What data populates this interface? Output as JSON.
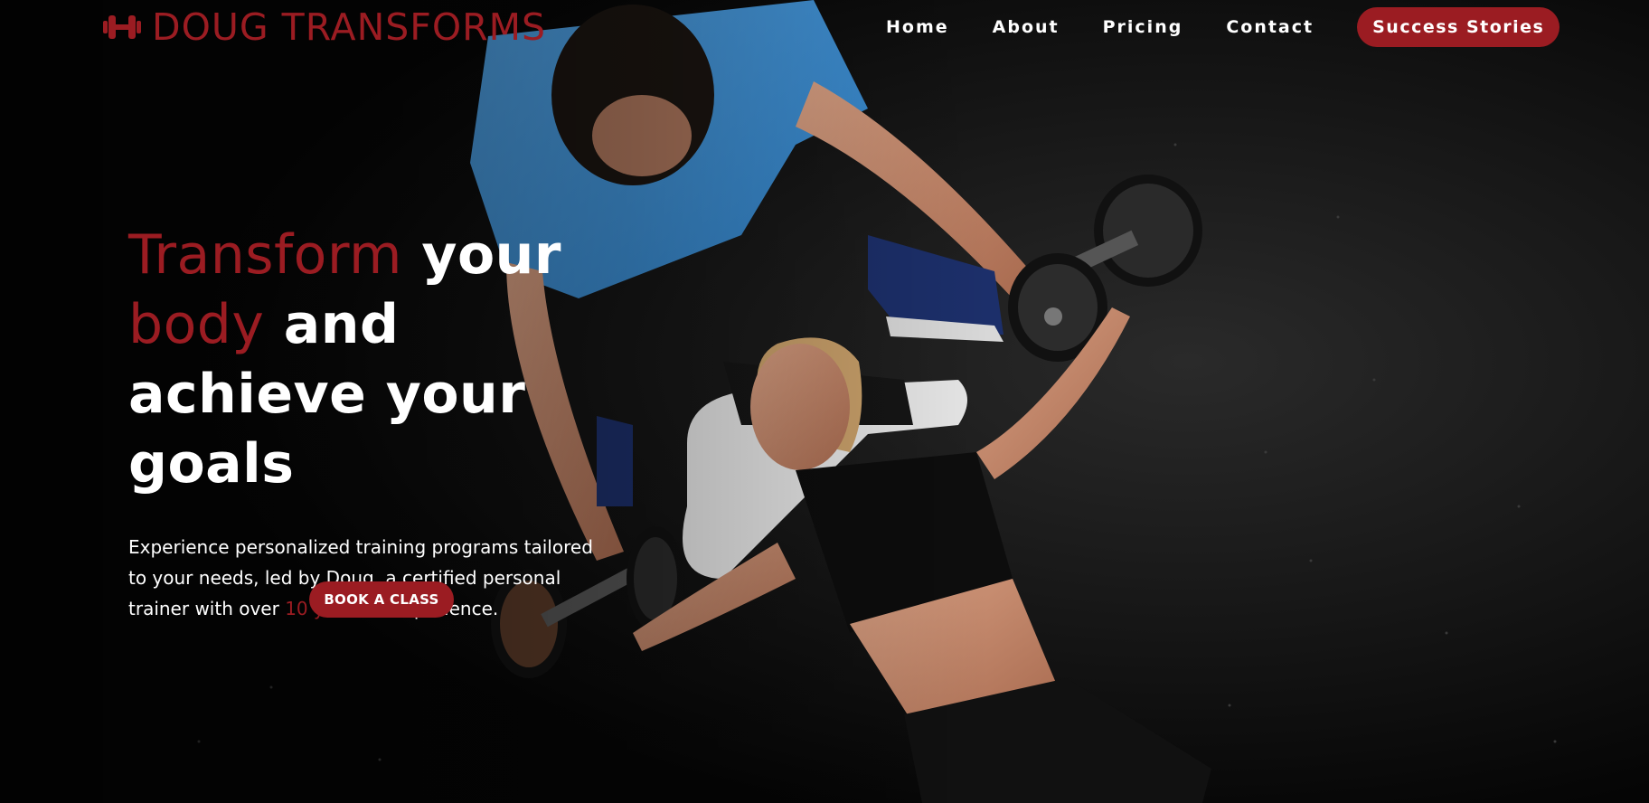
{
  "brand": {
    "name": "DOUG TRANSFORMS",
    "icon": "dumbbell-icon",
    "color": "#9b1c22"
  },
  "nav": {
    "items": [
      {
        "label": "Home"
      },
      {
        "label": "About"
      },
      {
        "label": "Pricing"
      },
      {
        "label": "Contact"
      }
    ],
    "cta_label": "Success Stories"
  },
  "hero": {
    "title_part1_accent": "Transform",
    "title_part2": " your",
    "title_part3_accent": "body",
    "title_part4": " and achieve your goals",
    "desc_part1": "Experience personalized training programs tailored to your needs, led by Doug, a certified personal trainer with over ",
    "desc_accent": "10 years",
    "desc_part2": " of experience.",
    "button_label": "BOOK A CLASS",
    "background": "hero-photo-trainer-and-client-bench-press"
  },
  "colors": {
    "accent": "#9b1c22",
    "text": "#ffffff",
    "background": "#0a0a0a"
  }
}
